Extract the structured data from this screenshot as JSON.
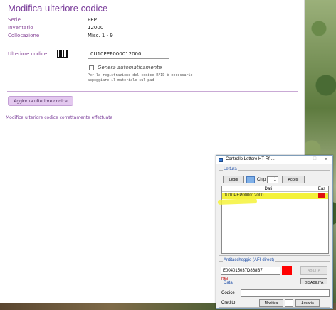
{
  "form": {
    "title": "Modifica ulteriore codice",
    "fields": [
      {
        "label": "Serie",
        "value": "PEP"
      },
      {
        "label": "Inventario",
        "value": "12000"
      },
      {
        "label": "Collocazione",
        "value": "Misc. 1 - 9"
      }
    ],
    "extra_code_label": "Ulteriore codice",
    "extra_code_value": "0U10PEP000012000",
    "auto_generate_label": "Genera automaticamente",
    "rfid_note": "Per la registrazione del codice RFID è necessario appoggiare il materiale sul pad",
    "update_button": "Aggiorna ulteriore codice",
    "success_message": "Modifica ulteriore codice correttamente effettuata"
  },
  "rfid_window": {
    "title": "Controllo Lettore HT-Rf-...",
    "controls": {
      "minimize": "—",
      "maximize": "□",
      "close": "✕"
    },
    "lettura": {
      "title": "Lettura",
      "leggi_button": "Leggi",
      "chip_label": "Chip",
      "chip_value": "1",
      "accesi_button": "Accesi",
      "col_dati": "Dati",
      "col_eas": "Eas",
      "rows": [
        {
          "code": "0U10PEP000012000",
          "eas_color": "#e01010"
        }
      ]
    },
    "antitaccheggio": {
      "title": "Antitaccheggio (AFI-direct)",
      "code": "E004015037D868B7",
      "status_label": "Rfid",
      "abilita_button": "ABILITA",
      "disabilita_button": "DISABILITA"
    },
    "data": {
      "title": "Data",
      "codice_label": "Codice",
      "credito_label": "Credito",
      "modifica_button": "Modifica",
      "associa_button": "Associa"
    }
  },
  "colors": {
    "accent": "#7a3c9a",
    "highlight": "#f4f23a",
    "alert": "#ff0000"
  }
}
